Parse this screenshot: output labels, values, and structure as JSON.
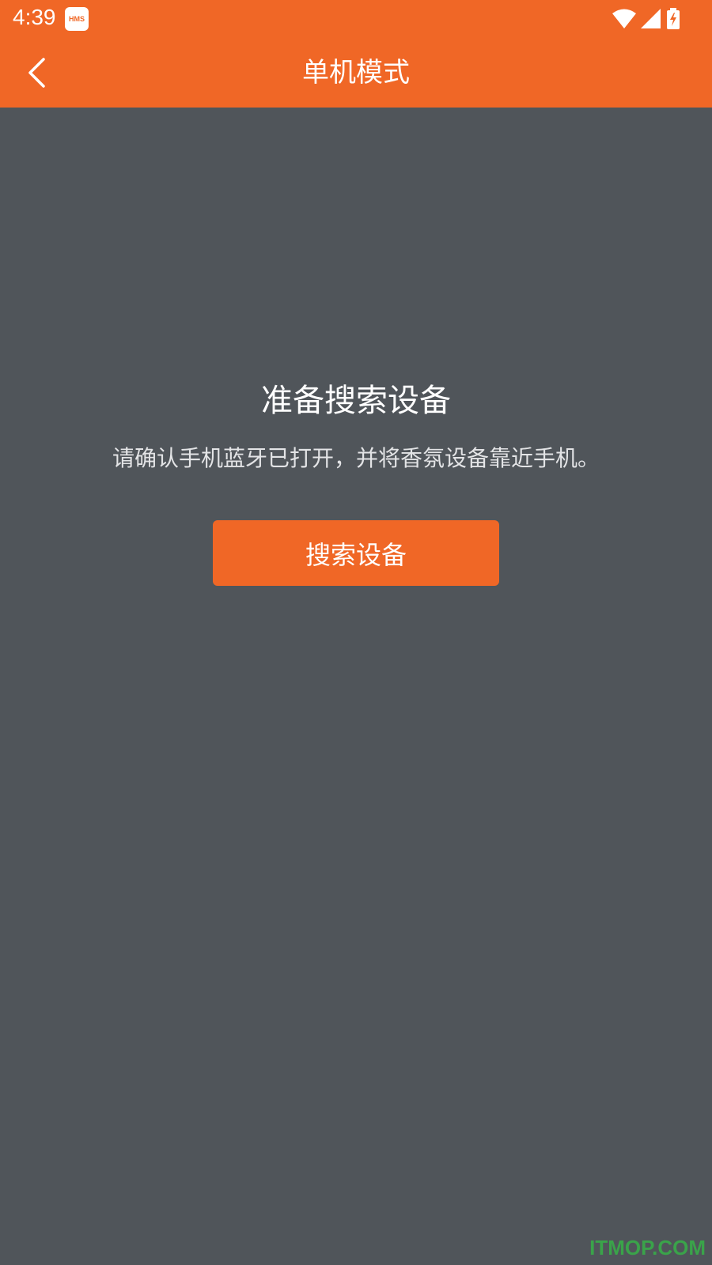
{
  "status_bar": {
    "time": "4:39",
    "hms_badge": "HMS",
    "icons": [
      "wifi-icon",
      "signal-icon",
      "battery-charging-icon"
    ]
  },
  "app_bar": {
    "title": "单机模式",
    "back_icon": "chevron-left-icon"
  },
  "content": {
    "title": "准备搜索设备",
    "description": "请确认手机蓝牙已打开，并将香氛设备靠近手机。",
    "search_button_label": "搜索设备"
  },
  "watermark": "ITMOP.COM",
  "colors": {
    "accent": "#f06726",
    "background": "#50555a",
    "watermark": "#3aa34a"
  }
}
